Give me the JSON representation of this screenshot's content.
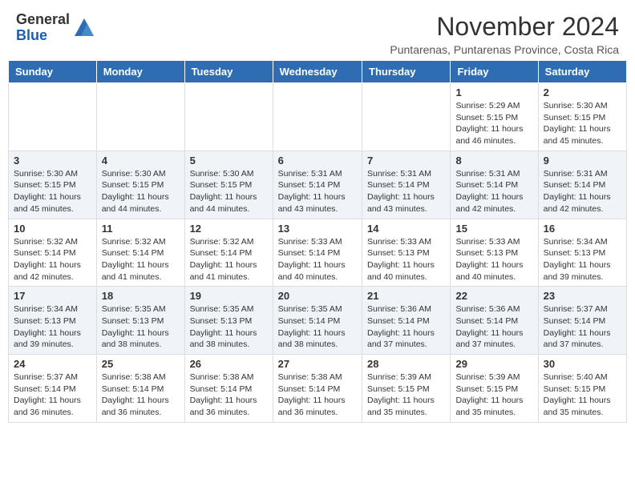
{
  "header": {
    "logo_general": "General",
    "logo_blue": "Blue",
    "month_title": "November 2024",
    "location": "Puntarenas, Puntarenas Province, Costa Rica"
  },
  "days_of_week": [
    "Sunday",
    "Monday",
    "Tuesday",
    "Wednesday",
    "Thursday",
    "Friday",
    "Saturday"
  ],
  "weeks": [
    [
      {
        "day": "",
        "info": ""
      },
      {
        "day": "",
        "info": ""
      },
      {
        "day": "",
        "info": ""
      },
      {
        "day": "",
        "info": ""
      },
      {
        "day": "",
        "info": ""
      },
      {
        "day": "1",
        "info": "Sunrise: 5:29 AM\nSunset: 5:15 PM\nDaylight: 11 hours and 46 minutes."
      },
      {
        "day": "2",
        "info": "Sunrise: 5:30 AM\nSunset: 5:15 PM\nDaylight: 11 hours and 45 minutes."
      }
    ],
    [
      {
        "day": "3",
        "info": "Sunrise: 5:30 AM\nSunset: 5:15 PM\nDaylight: 11 hours and 45 minutes."
      },
      {
        "day": "4",
        "info": "Sunrise: 5:30 AM\nSunset: 5:15 PM\nDaylight: 11 hours and 44 minutes."
      },
      {
        "day": "5",
        "info": "Sunrise: 5:30 AM\nSunset: 5:15 PM\nDaylight: 11 hours and 44 minutes."
      },
      {
        "day": "6",
        "info": "Sunrise: 5:31 AM\nSunset: 5:14 PM\nDaylight: 11 hours and 43 minutes."
      },
      {
        "day": "7",
        "info": "Sunrise: 5:31 AM\nSunset: 5:14 PM\nDaylight: 11 hours and 43 minutes."
      },
      {
        "day": "8",
        "info": "Sunrise: 5:31 AM\nSunset: 5:14 PM\nDaylight: 11 hours and 42 minutes."
      },
      {
        "day": "9",
        "info": "Sunrise: 5:31 AM\nSunset: 5:14 PM\nDaylight: 11 hours and 42 minutes."
      }
    ],
    [
      {
        "day": "10",
        "info": "Sunrise: 5:32 AM\nSunset: 5:14 PM\nDaylight: 11 hours and 42 minutes."
      },
      {
        "day": "11",
        "info": "Sunrise: 5:32 AM\nSunset: 5:14 PM\nDaylight: 11 hours and 41 minutes."
      },
      {
        "day": "12",
        "info": "Sunrise: 5:32 AM\nSunset: 5:14 PM\nDaylight: 11 hours and 41 minutes."
      },
      {
        "day": "13",
        "info": "Sunrise: 5:33 AM\nSunset: 5:14 PM\nDaylight: 11 hours and 40 minutes."
      },
      {
        "day": "14",
        "info": "Sunrise: 5:33 AM\nSunset: 5:13 PM\nDaylight: 11 hours and 40 minutes."
      },
      {
        "day": "15",
        "info": "Sunrise: 5:33 AM\nSunset: 5:13 PM\nDaylight: 11 hours and 40 minutes."
      },
      {
        "day": "16",
        "info": "Sunrise: 5:34 AM\nSunset: 5:13 PM\nDaylight: 11 hours and 39 minutes."
      }
    ],
    [
      {
        "day": "17",
        "info": "Sunrise: 5:34 AM\nSunset: 5:13 PM\nDaylight: 11 hours and 39 minutes."
      },
      {
        "day": "18",
        "info": "Sunrise: 5:35 AM\nSunset: 5:13 PM\nDaylight: 11 hours and 38 minutes."
      },
      {
        "day": "19",
        "info": "Sunrise: 5:35 AM\nSunset: 5:13 PM\nDaylight: 11 hours and 38 minutes."
      },
      {
        "day": "20",
        "info": "Sunrise: 5:35 AM\nSunset: 5:14 PM\nDaylight: 11 hours and 38 minutes."
      },
      {
        "day": "21",
        "info": "Sunrise: 5:36 AM\nSunset: 5:14 PM\nDaylight: 11 hours and 37 minutes."
      },
      {
        "day": "22",
        "info": "Sunrise: 5:36 AM\nSunset: 5:14 PM\nDaylight: 11 hours and 37 minutes."
      },
      {
        "day": "23",
        "info": "Sunrise: 5:37 AM\nSunset: 5:14 PM\nDaylight: 11 hours and 37 minutes."
      }
    ],
    [
      {
        "day": "24",
        "info": "Sunrise: 5:37 AM\nSunset: 5:14 PM\nDaylight: 11 hours and 36 minutes."
      },
      {
        "day": "25",
        "info": "Sunrise: 5:38 AM\nSunset: 5:14 PM\nDaylight: 11 hours and 36 minutes."
      },
      {
        "day": "26",
        "info": "Sunrise: 5:38 AM\nSunset: 5:14 PM\nDaylight: 11 hours and 36 minutes."
      },
      {
        "day": "27",
        "info": "Sunrise: 5:38 AM\nSunset: 5:14 PM\nDaylight: 11 hours and 36 minutes."
      },
      {
        "day": "28",
        "info": "Sunrise: 5:39 AM\nSunset: 5:15 PM\nDaylight: 11 hours and 35 minutes."
      },
      {
        "day": "29",
        "info": "Sunrise: 5:39 AM\nSunset: 5:15 PM\nDaylight: 11 hours and 35 minutes."
      },
      {
        "day": "30",
        "info": "Sunrise: 5:40 AM\nSunset: 5:15 PM\nDaylight: 11 hours and 35 minutes."
      }
    ]
  ]
}
